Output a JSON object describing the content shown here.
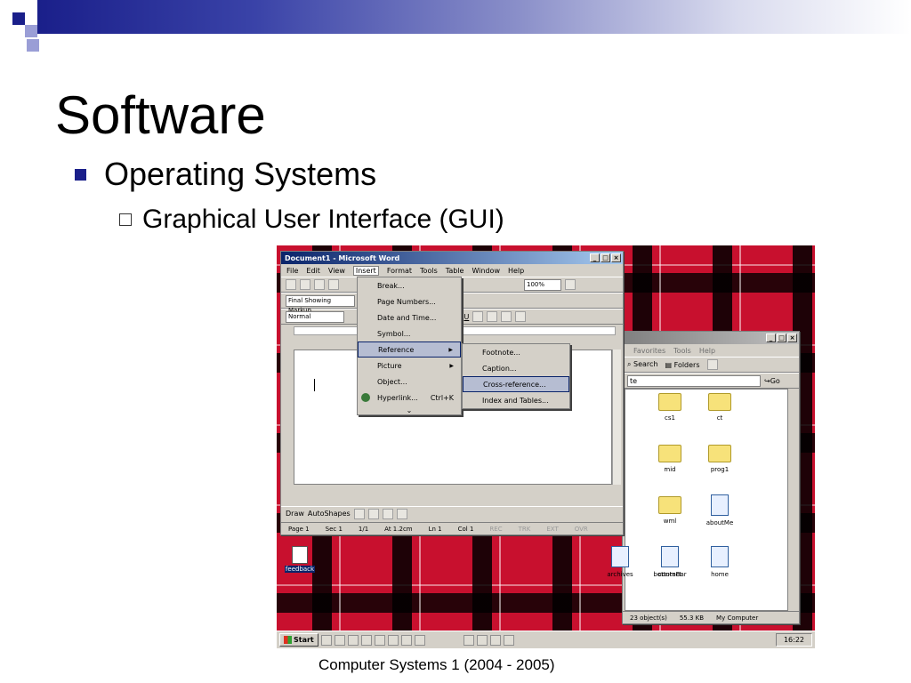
{
  "slide": {
    "title": "Software",
    "bullet_1": "Operating Systems",
    "bullet_2": "Graphical User Interface (GUI)",
    "footer": "Computer Systems 1 (2004 - 2005)"
  },
  "word": {
    "title": "Document1 - Microsoft Word",
    "menus": [
      "File",
      "Edit",
      "View",
      "Insert",
      "Format",
      "Tools",
      "Table",
      "Window",
      "Help"
    ],
    "zoom": "100%",
    "markup_combo": "Final Showing Markup",
    "style_combo": "Normal",
    "insert_menu": [
      "Break...",
      "Page Numbers...",
      "Date and Time...",
      "Symbol...",
      "Reference",
      "Picture",
      "Object...",
      "Hyperlink..."
    ],
    "hyperlink_shortcut": "Ctrl+K",
    "reference_submenu": [
      "Footnote...",
      "Caption...",
      "Cross-reference...",
      "Index and Tables..."
    ],
    "draw_toolbar": {
      "draw": "Draw",
      "autoshapes": "AutoShapes"
    },
    "status": {
      "page": "Page 1",
      "sec": "Sec 1",
      "pages": "1/1",
      "at": "At 1.2cm",
      "ln": "Ln 1",
      "col": "Col 1",
      "rec": "REC",
      "trk": "TRK",
      "ext": "EXT",
      "ovr": "OVR"
    }
  },
  "explorer": {
    "menus": [
      "Favorites",
      "Tools",
      "Help"
    ],
    "search": "Search",
    "folders": "Folders",
    "go": "Go",
    "address_tail": "te",
    "items": [
      "cs1",
      "ct",
      "mid",
      "prog1",
      "wml",
      "aboutMe",
      "archives",
      "bottomBar",
      "contact",
      "home"
    ],
    "status_objects": "23 object(s)",
    "status_size": "55.3 KB",
    "status_location": "My Computer"
  },
  "desktop": {
    "icon_label": "feedback"
  },
  "taskbar": {
    "start": "Start",
    "clock": "16:22"
  }
}
